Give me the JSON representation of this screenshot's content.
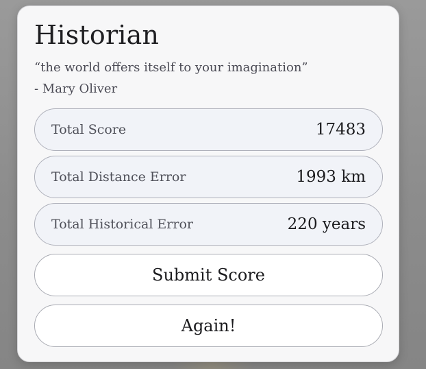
{
  "dialog": {
    "title": "Historian",
    "quote": "“the world offers itself to your imagination”",
    "author": "- Mary Oliver"
  },
  "stats": [
    {
      "label": "Total Score",
      "value": "17483"
    },
    {
      "label": "Total Distance Error",
      "value": "1993 km"
    },
    {
      "label": "Total Historical Error",
      "value": "220 years"
    }
  ],
  "buttons": {
    "submit_label": "Submit Score",
    "again_label": "Again!"
  },
  "colors": {
    "card_background": "#f7f7f8",
    "stat_background": "#f1f3f8",
    "button_background": "#ffffff",
    "backdrop": "#8e8e8e"
  }
}
